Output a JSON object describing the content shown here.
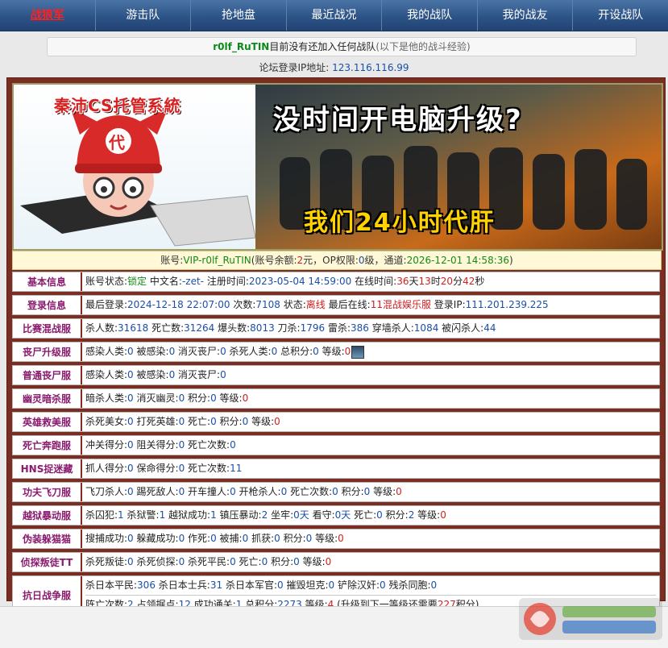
{
  "nav": {
    "items": [
      "战狼军",
      "游击队",
      "抢地盘",
      "最近战况",
      "我的战队",
      "我的战友",
      "开设战队"
    ]
  },
  "notice": {
    "username": "r0lf_RuTIN",
    "main": "目前没有还加入任何战队",
    "sub": "(以下是他的战斗经验)"
  },
  "ip_line": {
    "label": "论坛登录IP地址:",
    "ip": "123.116.116.99"
  },
  "banner": {
    "brand": "秦沛CS托管系統",
    "headline": "没时间开电脑升级?",
    "slogan": "我们24小时代肝",
    "hat_char": "代"
  },
  "account": {
    "label_account": "账号:",
    "account": "VIP-r0lf_RuTIN",
    "label_balance": "(账号余额:",
    "balance": "2",
    "label_op": "元，OP权限:",
    "op": "0",
    "label_channel": "级，通道:",
    "channel": "2026-12-01 14:58:36",
    "close": ")"
  },
  "rows": {
    "basic": {
      "label": "基本信息",
      "a": "账号状态:",
      "status": "锁定",
      "b": "中文名:",
      "cname": "-zet-",
      "c": "注册时间:",
      "reg": "2023-05-04 14:59:00",
      "d": "在线时间:",
      "days": "36",
      "e": "天",
      "hours": "13",
      "f": "时",
      "mins": "20",
      "g": "分",
      "secs": "42",
      "h": "秒"
    },
    "login": {
      "label": "登录信息",
      "a": "最后登录:",
      "last": "2024-12-18 22:07:00",
      "b": "次数:",
      "count": "7108",
      "c": "状态:",
      "status": "离线",
      "d": "最后在线:",
      "server": "11混战娱乐服",
      "e": "登录IP:",
      "ip": "111.201.239.225"
    },
    "match": {
      "label": "比赛混战服",
      "a": "杀人数:",
      "kills": "31618",
      "b": "死亡数:",
      "deaths": "31264",
      "c": "爆头数:",
      "hs": "8013",
      "d": "刀杀:",
      "knife": "1796",
      "e": "雷杀:",
      "nade": "386",
      "f": "穿墙杀人:",
      "wall": "1084",
      "g": "被闪杀人:",
      "flash": "44"
    },
    "zombie_up": {
      "label": "丧尸升级服",
      "a": "感染人类:",
      "v1": "0",
      "b": "被感染:",
      "v2": "0",
      "c": "消灭丧尸:",
      "v3": "0",
      "d": "杀死人类:",
      "v4": "0",
      "e": "总积分:",
      "v5": "0",
      "f": "等级:",
      "v6": "0"
    },
    "zombie": {
      "label": "普通丧尸服",
      "a": "感染人类:",
      "v1": "0",
      "b": "被感染:",
      "v2": "0",
      "c": "消灭丧尸:",
      "v3": "0"
    },
    "ghost": {
      "label": "幽灵暗杀服",
      "a": "暗杀人类:",
      "v1": "0",
      "b": "消灭幽灵:",
      "v2": "0",
      "c": "积分:",
      "v3": "0",
      "d": "等级:",
      "v4": "0"
    },
    "hero": {
      "label": "英雄救美服",
      "a": "杀死美女:",
      "v1": "0",
      "b": "打死英雄:",
      "v2": "0",
      "c": "死亡:",
      "v3": "0",
      "d": "积分:",
      "v4": "0",
      "e": "等级:",
      "v5": "0"
    },
    "deathrun": {
      "label": "死亡奔跑服",
      "a": "冲关得分:",
      "v1": "0",
      "b": "阻关得分:",
      "v2": "0",
      "c": "死亡次数:",
      "v3": "0"
    },
    "hns": {
      "label": "HNS捉迷藏",
      "a": "抓人得分:",
      "v1": "0",
      "b": "保命得分:",
      "v2": "0",
      "c": "死亡次数:",
      "v3": "11"
    },
    "kungfu": {
      "label": "功夫飞刀服",
      "a": "飞刀杀人:",
      "v1": "0",
      "b": "踢死敌人:",
      "v2": "0",
      "c": "开车撞人:",
      "v3": "0",
      "d": "开枪杀人:",
      "v4": "0",
      "e": "死亡次数:",
      "v5": "0",
      "f": "积分:",
      "v6": "0",
      "g": "等级:",
      "v7": "0"
    },
    "jail": {
      "label": "越狱暴动服",
      "a": "杀囚犯:",
      "v1": "1",
      "b": "杀狱警:",
      "v2": "1",
      "c": "越狱成功:",
      "v3": "1",
      "d": "镇压暴动:",
      "v4": "2",
      "e": "坐牢:",
      "v5": "0",
      "v5u": "天",
      "f": "看守:",
      "v6": "0",
      "v6u": "天",
      "g": "死亡:",
      "v7": "0",
      "h": "积分:",
      "v8": "2",
      "i": "等级:",
      "v9": "0"
    },
    "prop": {
      "label": "伪装躲猫猫",
      "a": "搜捕成功:",
      "v1": "0",
      "b": "躲藏成功:",
      "v2": "0",
      "c": "作死:",
      "v3": "0",
      "d": "被捕:",
      "v4": "0",
      "e": "抓获:",
      "v5": "0",
      "f": "积分:",
      "v6": "0",
      "g": "等级:",
      "v7": "0"
    },
    "ttt": {
      "label": "侦探叛徒TT",
      "a": "杀死叛徒:",
      "v1": "0",
      "b": "杀死侦探:",
      "v2": "0",
      "c": "杀死平民:",
      "v3": "0",
      "d": "死亡:",
      "v4": "0",
      "e": "积分:",
      "v5": "0",
      "f": "等级:",
      "v6": "0"
    },
    "war": {
      "label": "抗日战争服",
      "a": "杀日本平民:",
      "v1": "306",
      "b": "杀日本士兵:",
      "v2": "31",
      "c": "杀日本军官:",
      "v3": "0",
      "d": "摧毁坦克:",
      "v4": "0",
      "e": "铲除汉奸:",
      "v5": "0",
      "f": "残杀同胞:",
      "v6": "0",
      "g": "阵亡次数:",
      "v7": "2",
      "h": "占领据点:",
      "v8": "12",
      "i": "成功通关:",
      "v9": "1",
      "j": "总积分:",
      "v10": "2273",
      "k": "等级:",
      "v11": "4",
      "l": "(升级到下一等级还需要",
      "v12": "227",
      "m": "积分)"
    }
  },
  "colors": {
    "nav_bg": "#2d5487",
    "panel": "#7a2e22",
    "label": "#8a1a6e",
    "value_blue": "#1a4fa8",
    "value_red": "#d02020",
    "value_green": "#128a18"
  }
}
